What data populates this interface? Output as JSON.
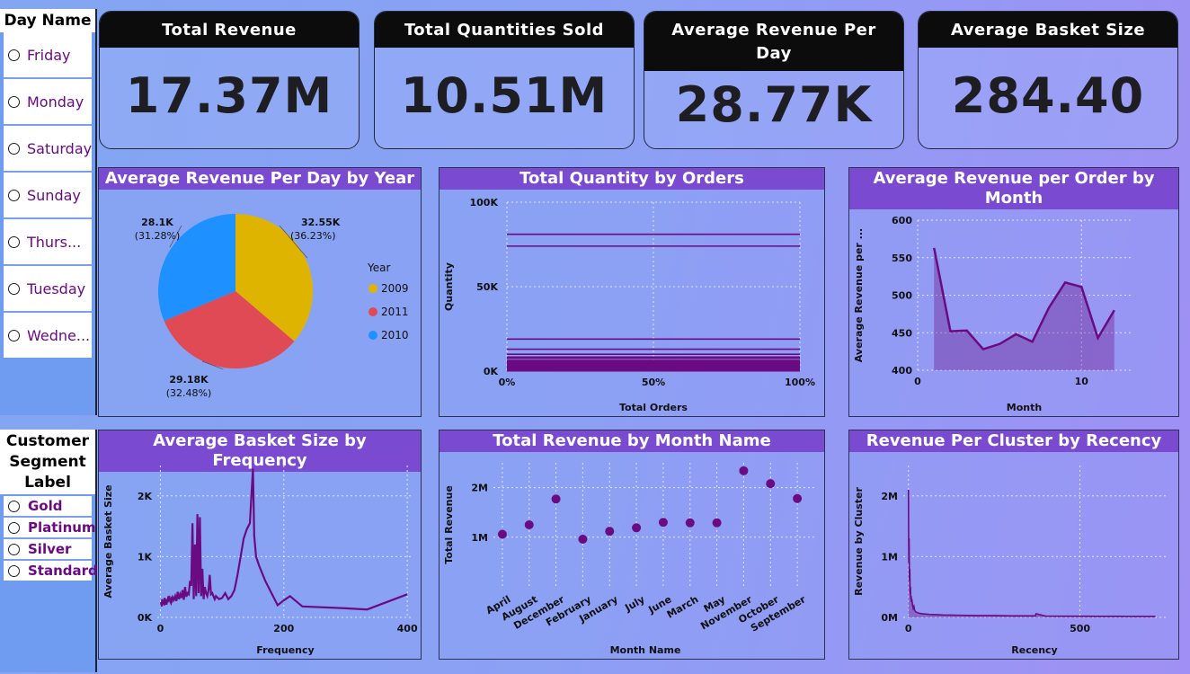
{
  "day_slicer": {
    "title": "Day Name",
    "items": [
      "Friday",
      "Monday",
      "Saturday",
      "Sunday",
      "Thurs...",
      "Tuesday",
      "Wedne..."
    ]
  },
  "segment_slicer": {
    "title": "Customer Segment Label",
    "items": [
      "Gold",
      "Platinum",
      "Silver",
      "Standard"
    ]
  },
  "kpis": [
    {
      "title": "Total Revenue",
      "value": "17.37M"
    },
    {
      "title": "Total Quantities Sold",
      "value": "10.51M"
    },
    {
      "title": "Average Revenue Per Day",
      "value": "28.77K"
    },
    {
      "title": "Average Basket Size",
      "value": "284.40"
    }
  ],
  "colors": {
    "purple": "#6a0b82",
    "panel_header": "#7a4bd0",
    "yellow": "#dfb400",
    "red": "#df4a55",
    "blue": "#1e90ff"
  },
  "chart_data": [
    {
      "type": "pie",
      "title": "Average Revenue Per Day by Year",
      "legend_title": "Year",
      "legend_position": "right",
      "slices": [
        {
          "name": "2009",
          "value": 32.55,
          "label": "32.55K",
          "percent": "(36.23%)",
          "color": "#dfb400"
        },
        {
          "name": "2011",
          "value": 29.18,
          "label": "29.18K",
          "percent": "(32.48%)",
          "color": "#df4a55"
        },
        {
          "name": "2010",
          "value": 28.1,
          "label": "28.1K",
          "percent": "(31.28%)",
          "color": "#1e90ff"
        }
      ]
    },
    {
      "type": "bar",
      "title": "Total Quantity by Orders",
      "xlabel": "Total Orders",
      "ylabel": "Quantity",
      "x_ticks": [
        "0%",
        "50%",
        "100%"
      ],
      "y_ticks": [
        {
          "v": 0,
          "t": "0K"
        },
        {
          "v": 50000,
          "t": "50K"
        },
        {
          "v": 100000,
          "t": "100K"
        }
      ],
      "ylim": [
        0,
        100000
      ],
      "lines": [
        81000,
        74000,
        19000,
        13000,
        10000,
        8000,
        6000,
        5000,
        4000,
        3000,
        2000,
        1500,
        1000,
        500
      ],
      "grid": true
    },
    {
      "type": "area",
      "title": "Average Revenue per Order by Month",
      "xlabel": "Month",
      "ylabel": "Average Revenue per ...",
      "xlim": [
        0,
        13
      ],
      "ylim": [
        400,
        600
      ],
      "x_ticks": [
        0,
        10
      ],
      "y_ticks": [
        400,
        450,
        500,
        550,
        600
      ],
      "x": [
        1,
        2,
        3,
        4,
        5,
        6,
        7,
        8,
        9,
        10,
        11,
        12
      ],
      "values": [
        563,
        452,
        453,
        428,
        435,
        448,
        438,
        483,
        517,
        511,
        443,
        480
      ],
      "grid": true
    },
    {
      "type": "line",
      "title": "Average Basket Size by Frequency",
      "xlabel": "Frequency",
      "ylabel": "Average Basket Size",
      "xlim": [
        -5,
        410
      ],
      "ylim": [
        0,
        2500
      ],
      "x_ticks": [
        0,
        200,
        400
      ],
      "y_ticks": [
        {
          "v": 0,
          "t": "0K"
        },
        {
          "v": 1000,
          "t": "1K"
        },
        {
          "v": 2000,
          "t": "2K"
        }
      ],
      "x": [
        1,
        2,
        3,
        4,
        5,
        6,
        7,
        8,
        9,
        10,
        11,
        12,
        13,
        14,
        15,
        16,
        17,
        18,
        19,
        20,
        22,
        24,
        26,
        28,
        30,
        32,
        34,
        36,
        38,
        40,
        42,
        44,
        46,
        48,
        50,
        52,
        54,
        56,
        58,
        60,
        62,
        64,
        66,
        68,
        70,
        72,
        74,
        76,
        78,
        80,
        82,
        84,
        86,
        88,
        90,
        95,
        100,
        105,
        110,
        115,
        120,
        125,
        130,
        135,
        140,
        145,
        150,
        152,
        155,
        160,
        170,
        180,
        190,
        200,
        210,
        230,
        300,
        335,
        400
      ],
      "values": [
        250,
        180,
        300,
        220,
        280,
        200,
        320,
        240,
        260,
        210,
        300,
        250,
        350,
        280,
        310,
        260,
        240,
        300,
        280,
        330,
        290,
        350,
        270,
        420,
        300,
        380,
        320,
        450,
        290,
        500,
        340,
        400,
        380,
        600,
        520,
        1550,
        300,
        1200,
        350,
        1700,
        400,
        1650,
        350,
        800,
        300,
        500,
        400,
        350,
        450,
        700,
        380,
        400,
        350,
        300,
        350,
        300,
        320,
        400,
        300,
        350,
        450,
        700,
        1000,
        1300,
        1450,
        1550,
        2450,
        1350,
        1000,
        850,
        600,
        400,
        200,
        280,
        350,
        180,
        150,
        130,
        380
      ],
      "grid": true
    },
    {
      "type": "scatter",
      "title": "Total Revenue by Month Name",
      "xlabel": "Month Name",
      "ylabel": "Total Revenue",
      "ylim": [
        0,
        2500000
      ],
      "y_ticks": [
        {
          "v": 1000000,
          "t": "1M"
        },
        {
          "v": 2000000,
          "t": "2M"
        }
      ],
      "categories": [
        "April",
        "August",
        "December",
        "February",
        "January",
        "July",
        "June",
        "March",
        "May",
        "November",
        "October",
        "September"
      ],
      "values": [
        1060000,
        1250000,
        1770000,
        960000,
        1120000,
        1190000,
        1300000,
        1290000,
        1290000,
        2340000,
        2080000,
        1780000
      ],
      "grid": true
    },
    {
      "type": "area",
      "title": "Revenue Per Cluster by Recency",
      "xlabel": "Recency",
      "ylabel": "Revenue by Cluster",
      "xlim": [
        -15,
        750
      ],
      "ylim": [
        0,
        2500000
      ],
      "x_ticks": [
        0,
        500
      ],
      "y_ticks": [
        {
          "v": 0,
          "t": "0M"
        },
        {
          "v": 1000000,
          "t": "1M"
        },
        {
          "v": 2000000,
          "t": "2M"
        }
      ],
      "x": [
        0,
        1,
        2,
        3,
        4,
        5,
        6,
        7,
        8,
        9,
        10,
        12,
        14,
        16,
        18,
        20,
        25,
        30,
        40,
        60,
        80,
        100,
        150,
        200,
        250,
        300,
        350,
        370,
        372,
        400,
        450,
        500,
        550,
        600,
        650,
        700,
        720
      ],
      "values": [
        2100000,
        900000,
        1300000,
        600000,
        800000,
        400000,
        500000,
        300000,
        350000,
        250000,
        300000,
        200000,
        150000,
        180000,
        120000,
        100000,
        80000,
        70000,
        60000,
        50000,
        45000,
        40000,
        35000,
        30000,
        30000,
        25000,
        25000,
        25000,
        60000,
        22000,
        20000,
        20000,
        18000,
        18000,
        15000,
        15000,
        15000
      ],
      "grid": true
    }
  ]
}
